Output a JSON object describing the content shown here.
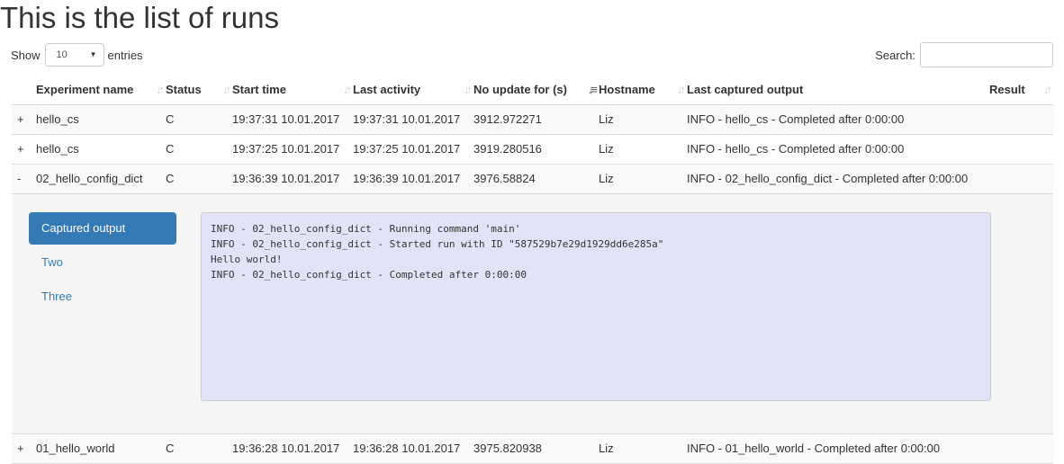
{
  "page": {
    "title": "This is the list of runs"
  },
  "controls": {
    "show_label": "Show",
    "entries_value": "10",
    "entries_label": "entries",
    "search_label": "Search:",
    "search_value": ""
  },
  "table": {
    "headers": [
      "",
      "Experiment name",
      "Status",
      "Start time",
      "Last activity",
      "No update for (s)",
      "Hostname",
      "Last captured output",
      "Result"
    ],
    "rows": [
      {
        "toggle": "+",
        "name": "hello_cs",
        "status": "C",
        "start": "19:37:31 10.01.2017",
        "last": "19:37:31 10.01.2017",
        "noupdate": "3912.972271",
        "host": "Liz",
        "output": "INFO - hello_cs - Completed after 0:00:00",
        "result": ""
      },
      {
        "toggle": "+",
        "name": "hello_cs",
        "status": "C",
        "start": "19:37:25 10.01.2017",
        "last": "19:37:25 10.01.2017",
        "noupdate": "3919.280516",
        "host": "Liz",
        "output": "INFO - hello_cs - Completed after 0:00:00",
        "result": ""
      },
      {
        "toggle": "-",
        "name": "02_hello_config_dict",
        "status": "C",
        "start": "19:36:39 10.01.2017",
        "last": "19:36:39 10.01.2017",
        "noupdate": "3976.58824",
        "host": "Liz",
        "output": "INFO - 02_hello_config_dict - Completed after 0:00:00",
        "result": ""
      },
      {
        "toggle": "+",
        "name": "01_hello_world",
        "status": "C",
        "start": "19:36:28 10.01.2017",
        "last": "19:36:28 10.01.2017",
        "noupdate": "3975.820938",
        "host": "Liz",
        "output": "INFO - 01_hello_world - Completed after 0:00:00",
        "result": ""
      }
    ]
  },
  "detail": {
    "tabs": [
      "Captured output",
      "Two",
      "Three"
    ],
    "active_tab": 0,
    "captured_output": "INFO - 02_hello_config_dict - Running command 'main'\nINFO - 02_hello_config_dict - Started run with ID \"587529b7e29d1929dd6e285a\"\nHello world!\nINFO - 02_hello_config_dict - Completed after 0:00:00"
  },
  "icons": {
    "sort": "sort-both-icon",
    "sort_active": "sort-desc-icon",
    "select_caret": "caret-down-icon"
  }
}
